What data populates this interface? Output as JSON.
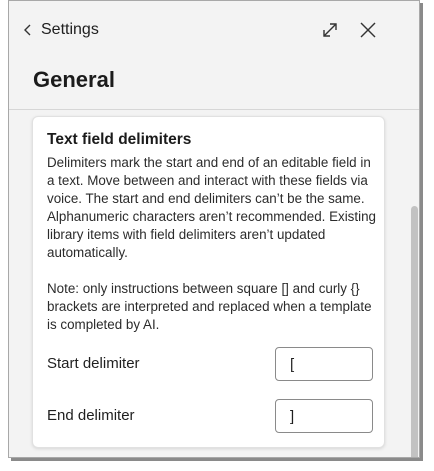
{
  "header": {
    "back_label": "Settings",
    "back_icon": "chevron-left-icon",
    "expand_icon": "expand-diagonal-icon",
    "close_icon": "close-icon"
  },
  "page": {
    "title": "General"
  },
  "delimiters_card": {
    "title": "Text field delimiters",
    "description": "Delimiters mark the start and end of an editable field in a text. Move between and interact with these fields via voice. The start and end delimiters can’t be the same. Alphanumeric characters aren’t recommended. Existing library items with field delimiters aren’t updated automatically.",
    "note": "Note: only instructions between square [] and curly {} brackets are interpreted and replaced when a template is completed by AI.",
    "start_label": "Start delimiter",
    "start_value": "[",
    "end_label": "End delimiter",
    "end_value": "]"
  },
  "colors": {
    "panel_background": "#f3f3f3",
    "card_background": "#ffffff",
    "scrollbar_thumb": "#c2c2c2"
  }
}
